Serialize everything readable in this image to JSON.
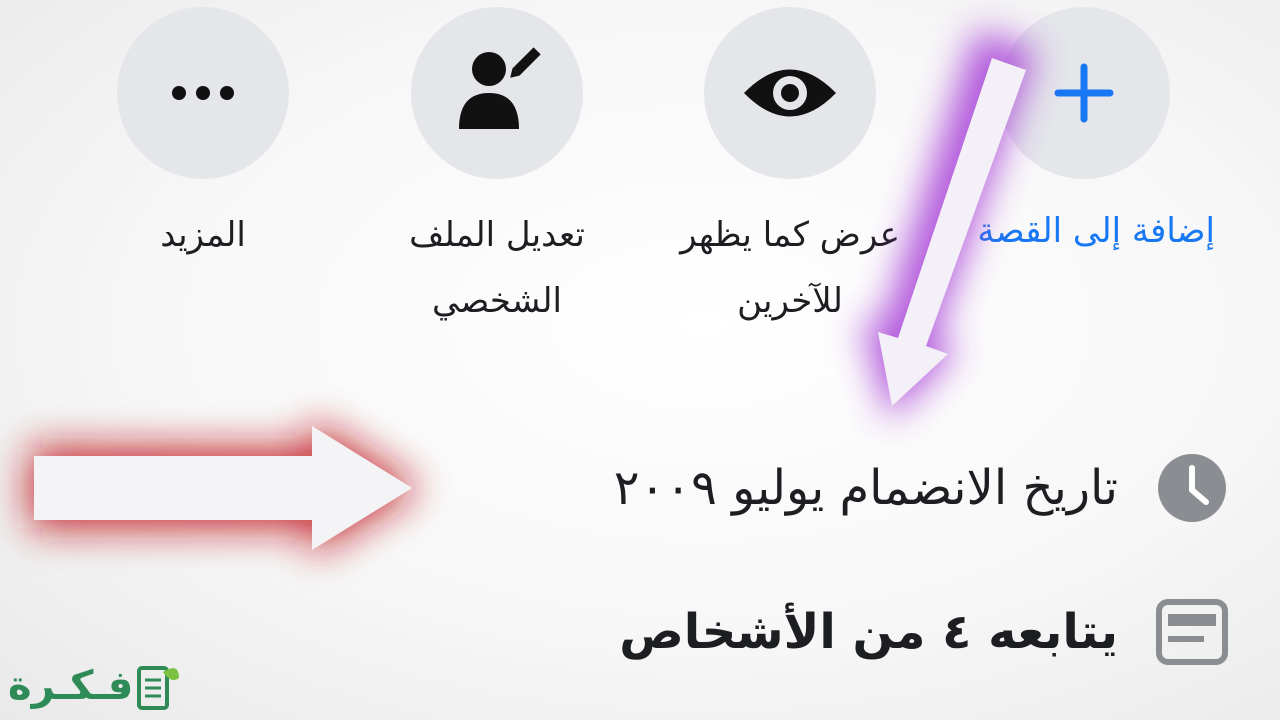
{
  "actions": [
    {
      "id": "add-story",
      "label": "إضافة إلى القصة",
      "icon": "plus-icon"
    },
    {
      "id": "view-as",
      "label_line1": "عرض كما يظهر",
      "label_line2": "للآخرين",
      "icon": "eye-icon"
    },
    {
      "id": "edit-profile",
      "label_line1": "تعديل الملف",
      "label_line2": "الشخصي",
      "icon": "edit-user-icon"
    },
    {
      "id": "more",
      "label": "المزيد",
      "icon": "more-dots-icon"
    }
  ],
  "info": {
    "joined": {
      "text": "تاريخ الانضمام يوليو ٢٠٠٩",
      "icon": "clock-icon"
    },
    "followers": {
      "text": "يتابعه ٤ من الأشخاص",
      "icon": "followers-icon"
    }
  },
  "logo": {
    "text": "فـكـرة",
    "icon": "book-leaf-icon"
  },
  "colors": {
    "accent": "#1877f2",
    "circle_bg": "#e4e6ea",
    "icon_gray": "#8a8d91",
    "arrow_glow_red": "#c0141b",
    "arrow_glow_purple": "#a53ad6",
    "logo_green": "#2e8b57"
  }
}
